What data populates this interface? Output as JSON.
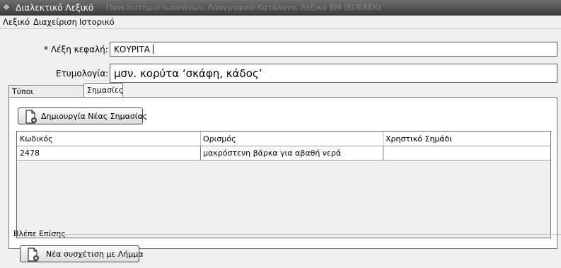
{
  "window": {
    "title": "Διαλεκτικό Λεξικό",
    "subtitle": "Πανεπιστήμιο Ιωαννίνων, Λαογραφικό Κατάλογο, Λεξικό ΒΜ (ΕΠΕΑΕΚ)"
  },
  "menu": {
    "items": [
      "Λεξικό",
      "Διαχείριση",
      "Ιστορικό"
    ]
  },
  "form": {
    "headword_label": "* Λέξη κεφαλή:",
    "headword_value": "ΚΟΥΡΙΤΑ",
    "etymology_label": "Ετυμολογία:",
    "etymology_value": "μσν. κορύτα ‘σκάφη, κάδος’"
  },
  "tabs": [
    {
      "label": "Τύποι Πραγμάτωσης",
      "active": false
    },
    {
      "label": "Σημασίες",
      "active": true
    }
  ],
  "meanings": {
    "create_button": "Δημιουργία Νέας Σημασίας",
    "columns": [
      "Κωδικός",
      "Ορισμός",
      "Χρηστικό Σημάδι"
    ],
    "rows": [
      {
        "code": "2478",
        "definition": "μακρόστενη βάρκα για αβαθή νερά",
        "usage_mark": ""
      }
    ]
  },
  "see_also": {
    "title": "Βλέπε Επίσης",
    "button": "Νέα συσχέτιση με Λήμμα"
  },
  "icons": {
    "app": "book-icon",
    "new_document": "new-document-icon"
  }
}
